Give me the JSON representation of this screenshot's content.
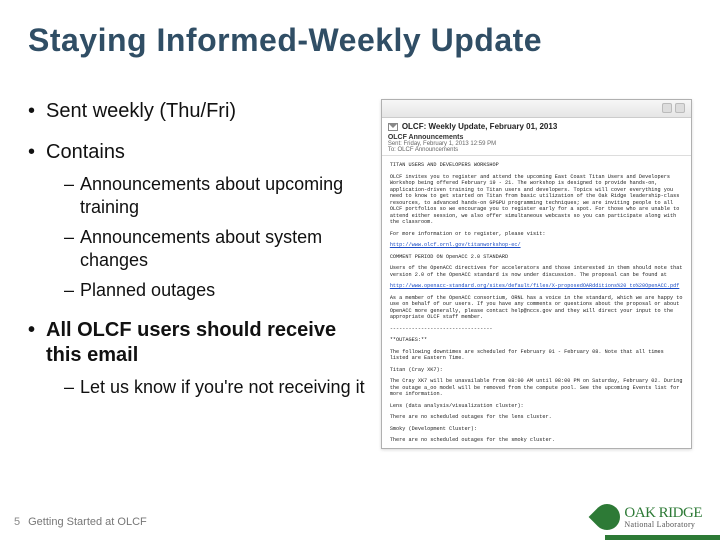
{
  "title": "Staying Informed-Weekly Update",
  "bullets": {
    "b1": "Sent weekly (Thu/Fri)",
    "b2": "Contains",
    "b2_sub": {
      "s1": "Announcements about upcoming training",
      "s2": "Announcements about system changes",
      "s3": "Planned outages"
    },
    "b3": "All OLCF users should receive this email",
    "b3_sub": {
      "s1": "Let us know if you're not receiving it"
    }
  },
  "footer": {
    "page": "5",
    "text": "Getting Started at OLCF"
  },
  "logo": {
    "line1": "OAK RIDGE",
    "line2": "National Laboratory"
  },
  "email": {
    "subject": "OLCF: Weekly Update, February 01, 2013",
    "from": "OLCF Announcements",
    "sent": "Sent:  Friday, February 1, 2013 12:59 PM",
    "to": "To:  OLCF Announcements",
    "body1_title": "TITAN USERS AND DEVELOPERS WORKSHOP",
    "body1": "OLCF invites you to register and attend the upcoming East Coast Titan Users and Developers Workshop being offered February 19 - 21. The workshop is designed to provide hands-on, application-driven training to Titan users and developers. Topics will cover everything you need to know to get started on Titan from basic utilization of the Oak Ridge leadership-class resources, to advanced hands-on GPGPU programming techniques; we are inviting people to all OLCF portfolios so we encourage you to register early for a spot. For those who are unable to attend either session, we also offer simultaneous webcasts so you can participate along with the classroom.",
    "body_more": "For more information or to register, please visit:",
    "body_link1": "http://www.olcf.ornl.gov/titanworkshop-ec/",
    "body2_title": "COMMENT PERIOD ON OpenACC 2.0 STANDARD",
    "body2": "Users of the OpenACC directives for accelerators and those interested in them should note that version 2.0 of the OpenACC standard is now under discussion. The proposal can be found at",
    "body_link2": "http://www.openacc-standard.org/sites/default/files/X-proposedOARdditions%20 to%20OpenACC.pdf",
    "body3": "As a member of the OpenACC consortium, ORNL has a voice in the standard, which we are happy to use on behalf of our users. If you have any comments or questions about the proposal or about OpenACC more generally, please contact help@nccs.gov and they will direct your input to the appropriate OLCF staff member.",
    "outages_sep": "---------------------------------",
    "outages_title": "**OUTAGES:**",
    "outages_line": "The following downtimes are scheduled for February 01 - February 08. Note that all times listed are Eastern Time.",
    "titan_label": "Titan (Cray XK7):",
    "titan_text": "The Cray XK7 will be unavailable from 08:00 AM until 08:00 PM on Saturday, February 02. During the outage a_oo model will be removed from the compute pool. See the upcoming Events list for more information.",
    "lens_label": "Lens (data analysis/visualization cluster):",
    "lens_text": "There are no scheduled outages for the lens cluster.",
    "smoky_label": "Smoky (Development Cluster):",
    "smoky_text": "There are no scheduled outages for the smoky cluster."
  }
}
